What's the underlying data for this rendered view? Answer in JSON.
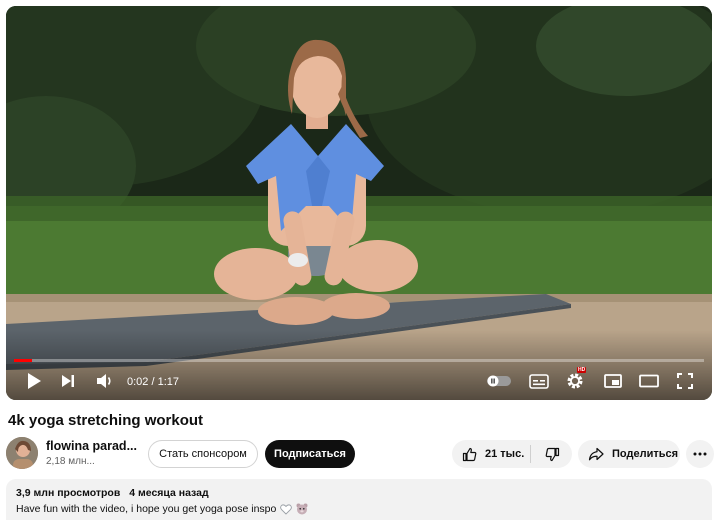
{
  "player": {
    "current_time": "0:02",
    "separator": "/",
    "duration": "1:17",
    "time_label": "0:02 / 1:17",
    "progress_fraction": 0.026,
    "hd_badge": "HD"
  },
  "video": {
    "title": "4k yoga stretching workout"
  },
  "channel": {
    "name": "flowina parad...",
    "subscribers": "2,18 млн..."
  },
  "actions": {
    "sponsor_label": "Стать спонсором",
    "subscribe_label": "Подписаться",
    "like_count": "21 тыс.",
    "share_label": "Поделиться"
  },
  "description": {
    "views": "3,9 млн просмотров",
    "age": "4 месяца назад",
    "text": "Have fun with the video, i hope you get yoga pose inspo"
  },
  "colors": {
    "progress": "#ff0000",
    "subscribe_bg": "#0f0f0f",
    "pill_bg": "#f2f2f2"
  },
  "icons": [
    "play-icon",
    "next-icon",
    "volume-icon",
    "autoplay-toggle-icon",
    "subtitles-icon",
    "settings-icon",
    "miniplayer-icon",
    "theater-icon",
    "fullscreen-icon",
    "like-icon",
    "dislike-icon",
    "share-icon",
    "more-icon",
    "heart-emoji",
    "bear-emoji"
  ]
}
